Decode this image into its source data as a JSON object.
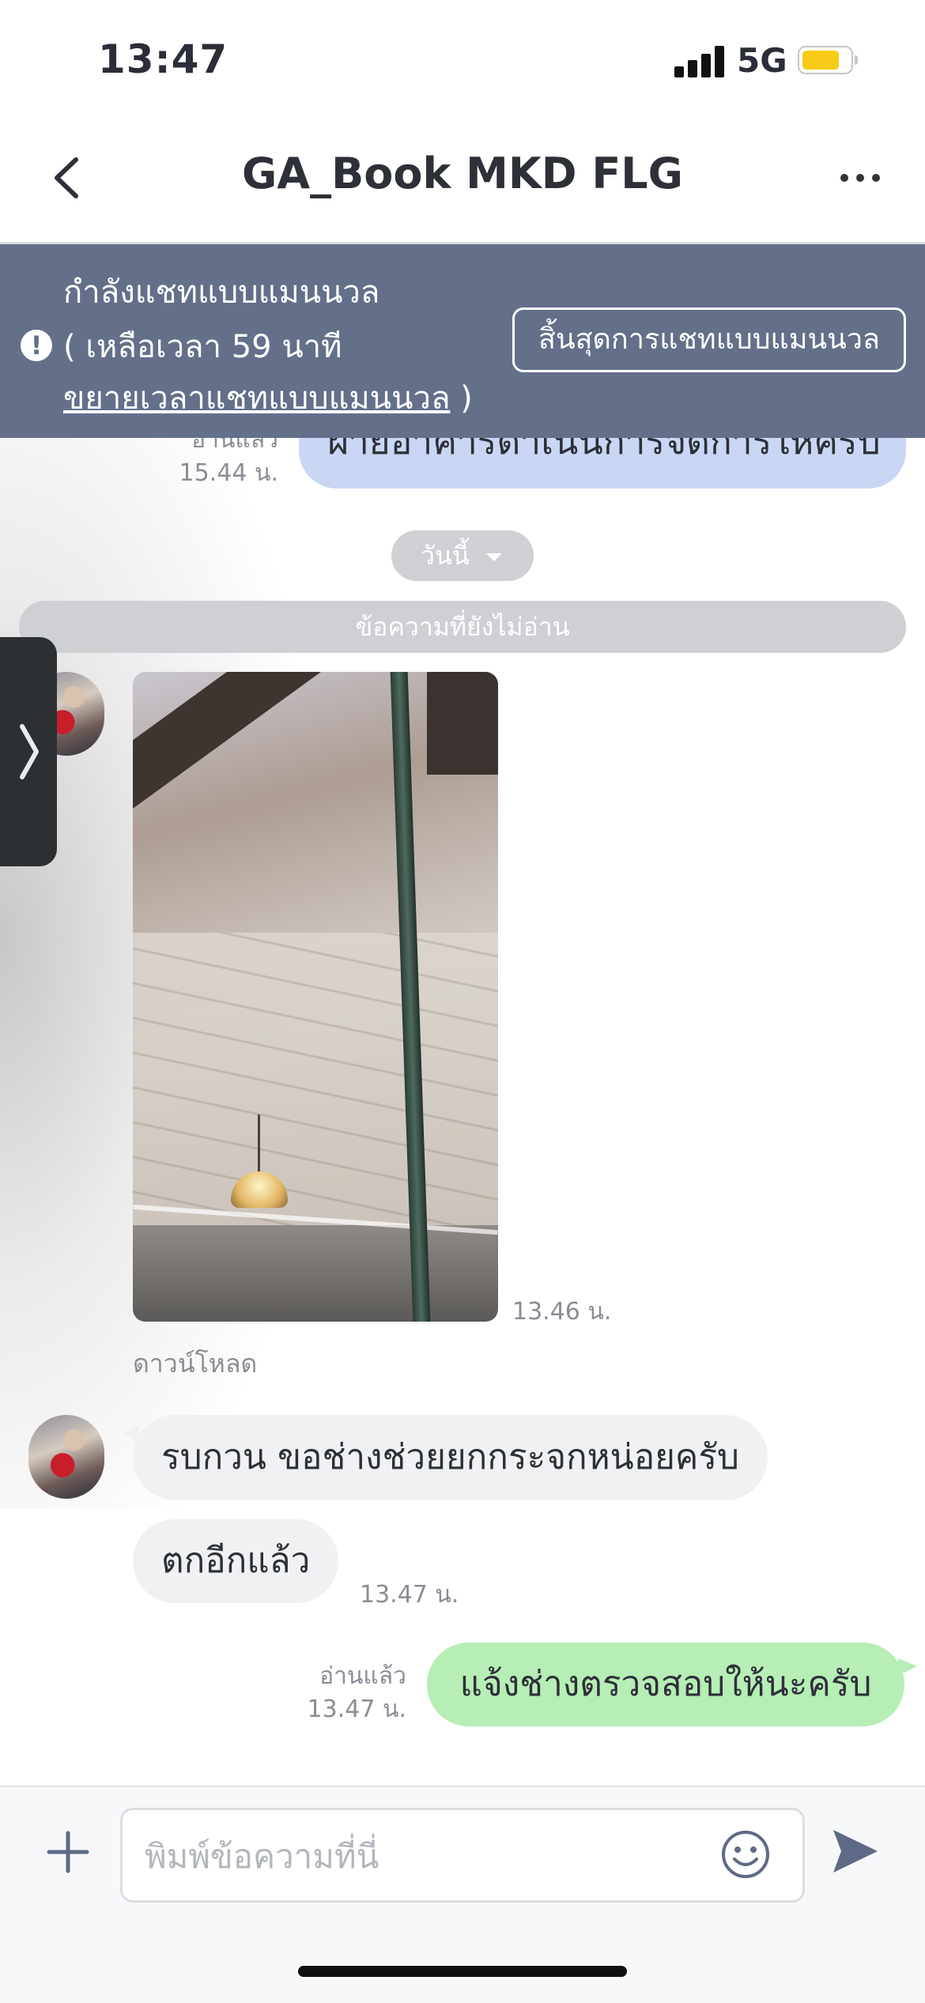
{
  "status_bar": {
    "time": "13:47",
    "network": "5G"
  },
  "header": {
    "title": "GA_Book MKD FLG",
    "back_icon": "chevron-left-icon",
    "more_icon": "more-horizontal-icon"
  },
  "manual_banner": {
    "line1": "กำลังแชทแบบแมนนวล",
    "line2": "( เหลือเวลา 59 นาที",
    "extend_link": "ขยายเวลาแชทแบบแมนนวล",
    "line3_suffix": " )",
    "end_button": "สิ้นสุดการแชทแบบแมนนวล"
  },
  "messages": {
    "prev_outgoing": {
      "text": "ฝ่ายอาคารดำเนินการจัดการให้ครับ",
      "read": "อ่านแล้ว",
      "time": "15.44 น."
    },
    "date_chip": "วันนี้",
    "unread_divider": "ข้อความที่ยังไม่อ่าน",
    "image_time": "13.46 น.",
    "download_label": "ดาวน์โหลด",
    "incoming1": "รบกวน ขอช่างช่วยยกกระจกหน่อยครับ",
    "incoming2": "ตกอีกแล้ว",
    "incoming2_time": "13.47 น.",
    "outgoing": {
      "text": "แจ้งช่างตรวจสอบให้นะครับ",
      "read": "อ่านแล้ว",
      "time": "13.47 น."
    }
  },
  "input_bar": {
    "placeholder": "พิมพ์ข้อความที่นี่"
  },
  "colors": {
    "banner": "#646f8a",
    "outgoing_green": "#b6eeb5",
    "outgoing_blue": "#c9d7f5",
    "battery": "#f7cb16"
  }
}
